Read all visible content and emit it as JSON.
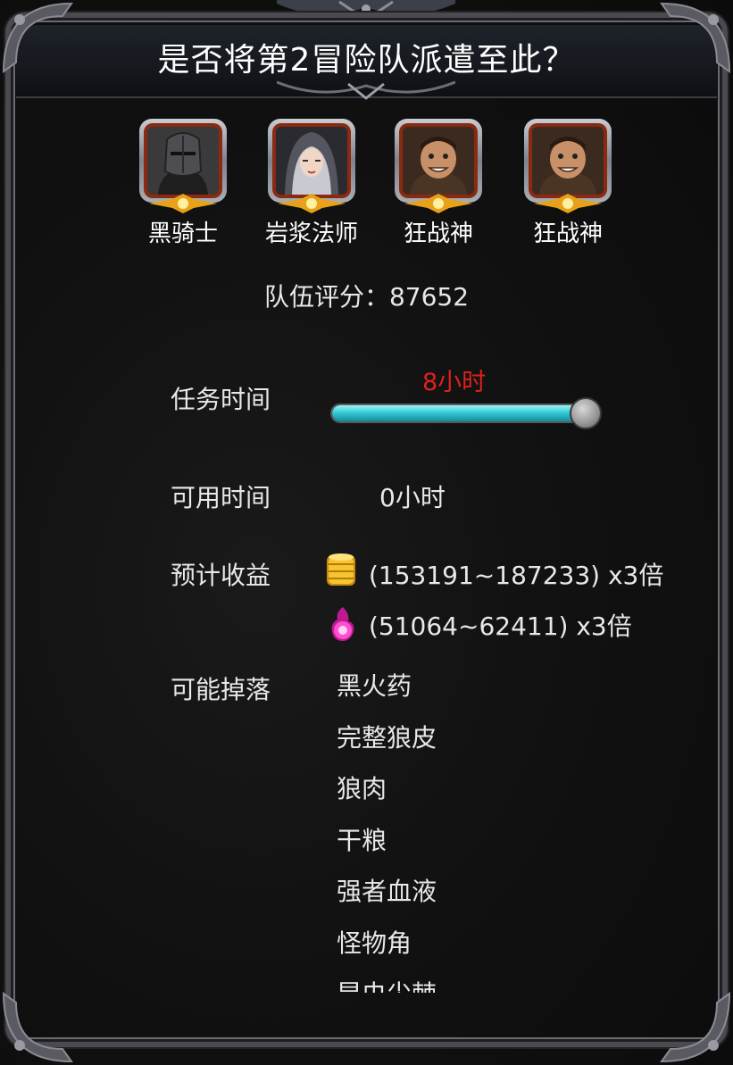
{
  "dialog": {
    "title": "是否将第2冒险队派遣至此？"
  },
  "team": {
    "heroes": [
      {
        "name": "黑骑士",
        "icon": "black-knight-portrait-icon"
      },
      {
        "name": "岩浆法师",
        "icon": "lava-mage-portrait-icon"
      },
      {
        "name": "狂战神",
        "icon": "berserker-portrait-icon"
      },
      {
        "name": "狂战神",
        "icon": "berserker-portrait-icon"
      }
    ],
    "score_label": "队伍评分：87652"
  },
  "mission": {
    "time_label": "任务时间",
    "time_value": "8小时",
    "slider_fraction": 1.0,
    "available_label": "可用时间",
    "available_value": "0小时",
    "reward_label": "预计收益",
    "rewards": [
      {
        "icon": "gold-coin-stack-icon",
        "text": "(153191~187233) x3倍"
      },
      {
        "icon": "magic-orb-icon",
        "text": "(51064~62411) x3倍"
      }
    ],
    "drops_label": "可能掉落",
    "drops": [
      "黑火药",
      "完整狼皮",
      "狼肉",
      "干粮",
      "强者血液",
      "怪物角",
      "昆虫尖棘"
    ]
  },
  "colors": {
    "accent_red": "#e0201a",
    "slider_cyan": "#35cbd6"
  }
}
